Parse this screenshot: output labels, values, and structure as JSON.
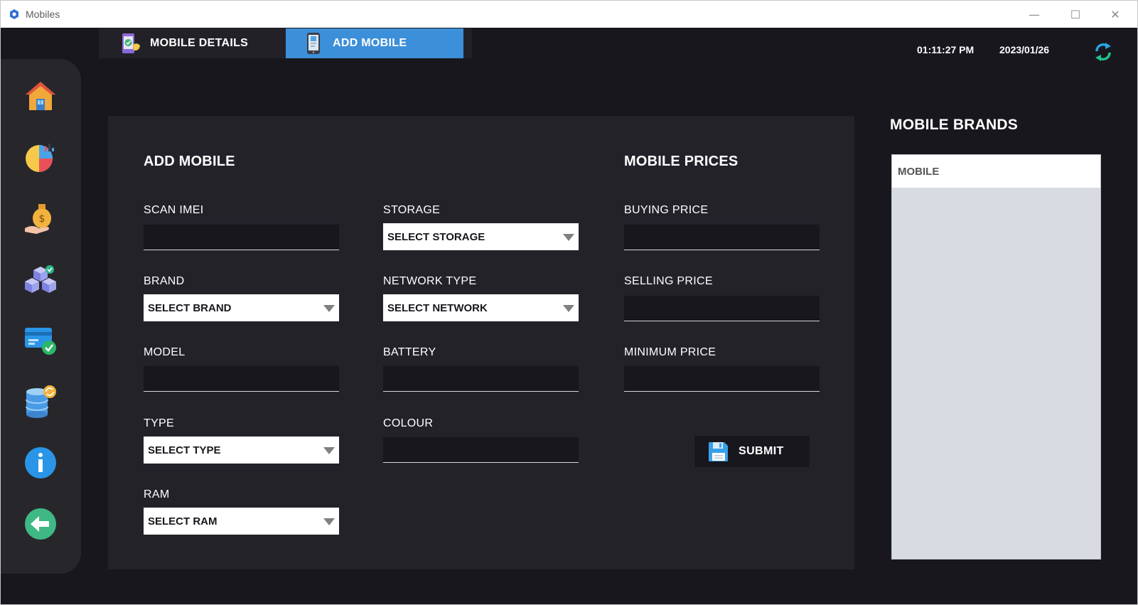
{
  "window": {
    "title": "Mobiles",
    "minimize_glyph": "—",
    "maximize_glyph": "☐",
    "close_glyph": "✕"
  },
  "tabs": [
    {
      "label": "MOBILE DETAILS",
      "icon": "phone-check-icon",
      "active": false
    },
    {
      "label": "ADD MOBILE",
      "icon": "smartphone-icon",
      "active": true
    }
  ],
  "header": {
    "time": "01:11:27 PM",
    "date": "2023/01/26"
  },
  "sidebar": {
    "items": [
      {
        "icon": "home-icon"
      },
      {
        "icon": "pie-chart-icon"
      },
      {
        "icon": "money-bag-icon"
      },
      {
        "icon": "stock-boxes-icon"
      },
      {
        "icon": "payment-card-icon"
      },
      {
        "icon": "database-sync-icon"
      },
      {
        "icon": "info-icon"
      },
      {
        "icon": "back-arrow-icon"
      }
    ]
  },
  "form": {
    "title": "ADD MOBILE",
    "prices_title": "MOBILE PRICES",
    "scan_imei": {
      "label": "SCAN IMEI",
      "value": ""
    },
    "brand": {
      "label": "BRAND",
      "value": "SELECT BRAND"
    },
    "model": {
      "label": "MODEL",
      "value": ""
    },
    "type": {
      "label": "TYPE",
      "value": "SELECT TYPE"
    },
    "ram": {
      "label": "RAM",
      "value": "SELECT RAM"
    },
    "storage": {
      "label": "STORAGE",
      "value": "SELECT STORAGE"
    },
    "network_type": {
      "label": "NETWORK TYPE",
      "value": "SELECT NETWORK"
    },
    "battery": {
      "label": "BATTERY",
      "value": ""
    },
    "colour": {
      "label": "COLOUR",
      "value": ""
    },
    "buying_price": {
      "label": "BUYING PRICE",
      "value": ""
    },
    "selling_price": {
      "label": "SELLING PRICE",
      "value": ""
    },
    "minimum_price": {
      "label": "MINIMUM PRICE",
      "value": ""
    },
    "submit_label": "SUBMIT"
  },
  "brands": {
    "title": "MOBILE BRANDS",
    "column_header": "MOBILE",
    "rows": []
  },
  "colors": {
    "background": "#18171d",
    "panel": "#232229",
    "sidebar": "#27272b",
    "accent": "#3c8fd9"
  }
}
